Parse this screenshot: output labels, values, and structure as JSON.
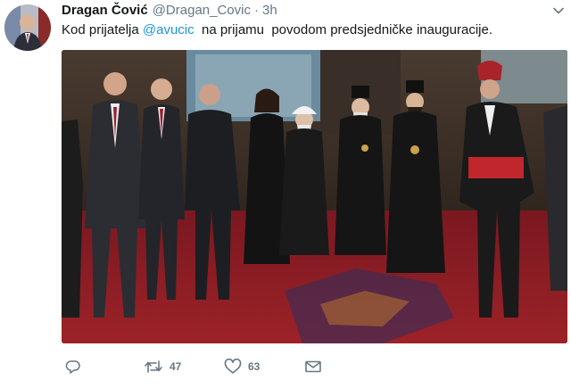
{
  "tweet": {
    "display_name": "Dragan Čović",
    "handle": "@Dragan_Covic",
    "separator": "·",
    "time": "3h",
    "text_before": "Kod prijatelja ",
    "mention": "@avucic",
    "text_after": "  na prijamu  povodom predsjedničke inauguracije."
  },
  "icons": {
    "avatar": "profile-photo",
    "caret": "chevron-down-icon",
    "reply": "reply-icon",
    "retweet": "retweet-icon",
    "like": "heart-icon",
    "message": "envelope-icon"
  },
  "actions": {
    "retweet_count": "47",
    "like_count": "63"
  },
  "colors": {
    "text": "#14171a",
    "secondary": "#657786",
    "link": "#1b95e0",
    "carpet": "#8b1c24",
    "wall": "#5b4636"
  }
}
